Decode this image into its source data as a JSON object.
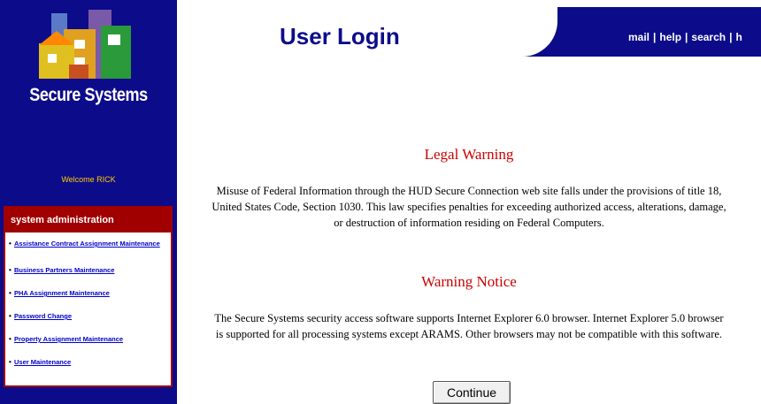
{
  "sidebar": {
    "brand": "Secure Systems",
    "welcome": "Welcome RICK",
    "admin": {
      "header": "system administration",
      "items": [
        "Assistance Contract Assignment Maintenance",
        "Business Partners Maintenance",
        "PHA Assignment Maintenance",
        "Password Change",
        "Property Assignment Maintenance",
        "User Maintenance"
      ]
    }
  },
  "header": {
    "title": "User Login",
    "links": [
      "mail",
      "help",
      "search",
      "h"
    ]
  },
  "main": {
    "legal_title": "Legal Warning",
    "legal_text_line1": "Misuse of Federal Information through the HUD Secure Connection web site falls under the provisions of title 18,",
    "legal_text_line2": "United States Code, Section 1030. This law specifies penalties for exceeding authorized access, alterations, damage,",
    "legal_text_line3": "or destruction of information residing on Federal Computers.",
    "notice_title": "Warning Notice",
    "notice_text_line1": "The Secure Systems security access software supports Internet Explorer 6.0 browser. Internet Explorer 5.0 browser",
    "notice_text_line2": "is supported for all processing systems except ARAMS. Other browsers may not be compatible with this software.",
    "continue_label": "Continue"
  },
  "colors": {
    "navy": "#0c0c8a",
    "dark_red": "#a00000",
    "warning_red": "#cc0000",
    "welcome_yellow": "#ffcc00"
  }
}
